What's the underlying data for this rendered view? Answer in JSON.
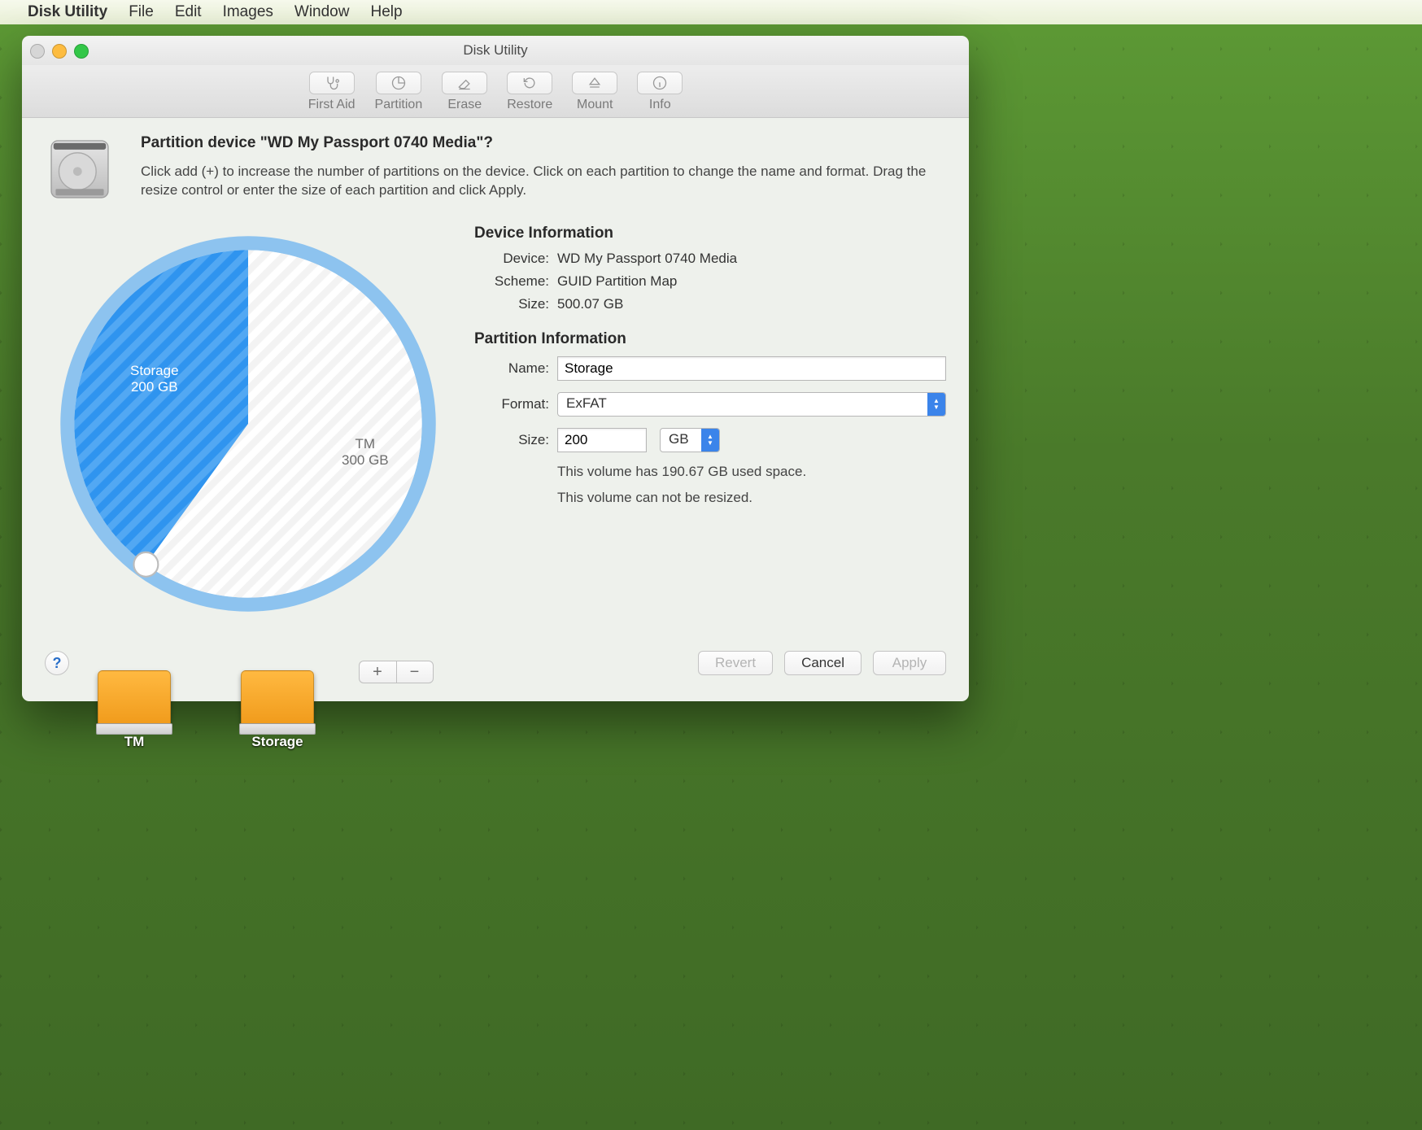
{
  "menubar": {
    "app": "Disk Utility",
    "items": [
      "File",
      "Edit",
      "Images",
      "Window",
      "Help"
    ]
  },
  "window": {
    "title": "Disk Utility"
  },
  "toolbar": {
    "buttons": [
      "First Aid",
      "Partition",
      "Erase",
      "Restore",
      "Mount",
      "Info"
    ]
  },
  "sheet": {
    "title": "Partition device \"WD My Passport 0740 Media\"?",
    "description": "Click add (+) to increase the number of partitions on the device. Click on each partition to change the name and format. Drag the resize control or enter the size of each partition and click Apply."
  },
  "device": {
    "section": "Device Information",
    "labels": {
      "device": "Device:",
      "scheme": "Scheme:",
      "size": "Size:"
    },
    "name": "WD My Passport 0740 Media",
    "scheme": "GUID Partition Map",
    "size": "500.07 GB"
  },
  "partition": {
    "section": "Partition Information",
    "labels": {
      "name": "Name:",
      "format": "Format:",
      "size": "Size:"
    },
    "name": "Storage",
    "format": "ExFAT",
    "size_value": "200",
    "size_unit": "GB",
    "used_note": "This volume has 190.67 GB used space.",
    "resize_note": "This volume can not be resized."
  },
  "buttons": {
    "revert": "Revert",
    "cancel": "Cancel",
    "apply": "Apply",
    "add": "+",
    "remove": "−",
    "help": "?"
  },
  "desktop": {
    "drives": [
      {
        "label": "TM"
      },
      {
        "label": "Storage"
      }
    ]
  },
  "chart_data": {
    "type": "pie",
    "title": "",
    "series": [
      {
        "name": "Storage",
        "value": 200,
        "unit": "GB",
        "selected": true,
        "label_line1": "Storage",
        "label_line2": "200 GB"
      },
      {
        "name": "TM",
        "value": 300,
        "unit": "GB",
        "selected": false,
        "label_line1": "TM",
        "label_line2": "300 GB"
      }
    ],
    "total": 500.07
  }
}
